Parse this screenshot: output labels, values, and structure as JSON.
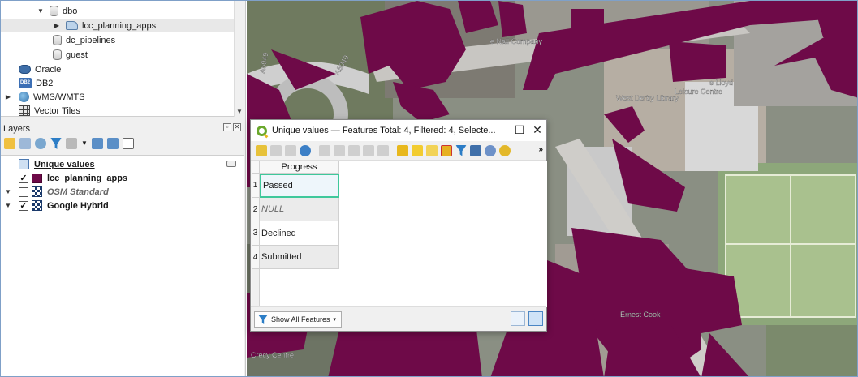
{
  "browser": {
    "items": [
      {
        "label": "dbo",
        "level": 2,
        "icon": "database-icon",
        "expanded": true
      },
      {
        "label": "lcc_planning_apps",
        "level": 3,
        "icon": "schema-icon",
        "collapsed": true,
        "selected": true
      },
      {
        "label": "dc_pipelines",
        "level": 3,
        "icon": "database-icon"
      },
      {
        "label": "guest",
        "level": 3,
        "icon": "database-icon"
      },
      {
        "label": "Oracle",
        "level": 1,
        "icon": "oracle-icon"
      },
      {
        "label": "DB2",
        "level": 1,
        "icon": "db2-icon"
      },
      {
        "label": "WMS/WMTS",
        "level": 1,
        "icon": "globe-icon",
        "collapsed": true
      },
      {
        "label": "Vector Tiles",
        "level": 1,
        "icon": "vector-tiles-icon"
      }
    ]
  },
  "layers_panel": {
    "title": "Layers",
    "layers": [
      {
        "label": "Unique values",
        "style": "bold-underline",
        "checkbox": false,
        "icon": "unique-values-icon"
      },
      {
        "label": "lcc_planning_apps",
        "style": "bold",
        "checked": true,
        "icon": "polygon-swatch-icon"
      },
      {
        "label": "OSM Standard",
        "style": "italic-grey",
        "checked": false,
        "icon": "raster-tile-icon"
      },
      {
        "label": "Google Hybrid",
        "style": "bold",
        "checked": true,
        "icon": "raster-tile-icon"
      }
    ]
  },
  "attribute_table": {
    "title": "Unique values — Features Total: 4, Filtered: 4, Selecte...",
    "column_header": "Progress",
    "rows": [
      {
        "num": "1",
        "value": "Passed"
      },
      {
        "num": "2",
        "value": "NULL"
      },
      {
        "num": "3",
        "value": "Declined"
      },
      {
        "num": "4",
        "value": "Submitted"
      }
    ],
    "filter_button_label": "Show All Features",
    "more_glyph": "»"
  },
  "map": {
    "labels": [
      "e Nall Company",
      "West Derby Library",
      "e Lloyd",
      "Leisure Centre",
      "Ernest Cook",
      "A5049",
      "A5049",
      "Crecy Centre"
    ]
  },
  "colors": {
    "polygon_fill": "#6e0a48",
    "selection_border": "#3fc89b",
    "qgis_green": "#6aa82c"
  }
}
